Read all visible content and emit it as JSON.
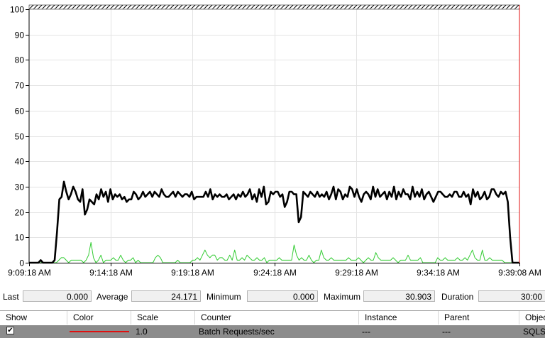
{
  "chart_data": {
    "type": "line",
    "ylim": [
      0,
      100
    ],
    "yticks": [
      "0",
      "10",
      "20",
      "30",
      "40",
      "50",
      "60",
      "70",
      "80",
      "90",
      "100"
    ],
    "xticks": [
      "9:09:18 AM",
      "9:14:18 AM",
      "9:19:18 AM",
      "9:24:18 AM",
      "9:29:18 AM",
      "9:34:18 AM",
      "9:39:08 AM"
    ],
    "grid": true,
    "series": [
      {
        "name": "Batch Requests/sec",
        "color": "#000000",
        "values": [
          0,
          0,
          0,
          0,
          0,
          1,
          0,
          0,
          0,
          0,
          0,
          1,
          12,
          25,
          26,
          32,
          28,
          25,
          27,
          30,
          28,
          25,
          24,
          29,
          19,
          21,
          25,
          24,
          23,
          27,
          25,
          29,
          26,
          28,
          24,
          29,
          25,
          27,
          26,
          27,
          25,
          26,
          24,
          25,
          25,
          28,
          27,
          25,
          26,
          28,
          26,
          27,
          28,
          26,
          28,
          27,
          26,
          29,
          27,
          26,
          26,
          27,
          28,
          26,
          28,
          27,
          26,
          27,
          27,
          26,
          28,
          25,
          26,
          26,
          26,
          26,
          28,
          26,
          29,
          25,
          27,
          26,
          27,
          26,
          26,
          27,
          25,
          26,
          27,
          25,
          27,
          26,
          28,
          26,
          27,
          29,
          25,
          27,
          24,
          29,
          26,
          30,
          23,
          24,
          28,
          27,
          28,
          28,
          26,
          27,
          22,
          24,
          28,
          28,
          27,
          27,
          16,
          18,
          28,
          27,
          26,
          28,
          27,
          26,
          28,
          26,
          27,
          26,
          28,
          25,
          27,
          30,
          25,
          29,
          28,
          25,
          27,
          26,
          30,
          29,
          26,
          29,
          26,
          24,
          27,
          28,
          27,
          25,
          30,
          26,
          29,
          26,
          27,
          28,
          25,
          28,
          26,
          30,
          25,
          28,
          26,
          29,
          27,
          27,
          25,
          30,
          26,
          28,
          26,
          29,
          25,
          27,
          28,
          26,
          24,
          26,
          28,
          28,
          27,
          26,
          26,
          27,
          26,
          28,
          28,
          26,
          26,
          28,
          26,
          27,
          23,
          29,
          26,
          28,
          25,
          26,
          28,
          25,
          26,
          29,
          29,
          27,
          26,
          28,
          27,
          28,
          24,
          10,
          0,
          0,
          0,
          0
        ]
      },
      {
        "name": "",
        "color": "#33cc33",
        "values": [
          0,
          0,
          0,
          0,
          0,
          0,
          0,
          0,
          0,
          0,
          0,
          0,
          1,
          2,
          2,
          1,
          0,
          1,
          1,
          1,
          1,
          1,
          0,
          1,
          3,
          8,
          2,
          0,
          1,
          3,
          0,
          1,
          1,
          1,
          2,
          1,
          1,
          3,
          1,
          0,
          1,
          1,
          2,
          0,
          1,
          0,
          0,
          0,
          0,
          0,
          0,
          2,
          3,
          2,
          0,
          0,
          0,
          0,
          0,
          0,
          1,
          0,
          0,
          0,
          0,
          0,
          1,
          1,
          2,
          1,
          3,
          5,
          3,
          2,
          3,
          3,
          1,
          2,
          2,
          1,
          1,
          3,
          1,
          5,
          1,
          1,
          2,
          1,
          3,
          2,
          1,
          1,
          2,
          1,
          1,
          2,
          0,
          1,
          1,
          1,
          1,
          2,
          1,
          1,
          1,
          1,
          1,
          7,
          3,
          1,
          2,
          1,
          1,
          3,
          1,
          0,
          1,
          1,
          5,
          2,
          1,
          1,
          2,
          1,
          1,
          1,
          1,
          1,
          1,
          2,
          1,
          1,
          1,
          2,
          1,
          0,
          1,
          2,
          1,
          1,
          4,
          2,
          1,
          1,
          1,
          1,
          1,
          2,
          1,
          0,
          1,
          1,
          1,
          3,
          1,
          1,
          1,
          1,
          2,
          0,
          0,
          0,
          0,
          0,
          0,
          2,
          1,
          1,
          2,
          1,
          1,
          1,
          1,
          2,
          1,
          1,
          2,
          1,
          3,
          5,
          2,
          1,
          1,
          5,
          1,
          1,
          2,
          1,
          1,
          1,
          1,
          1,
          0,
          0,
          0,
          0,
          0,
          0,
          0
        ]
      }
    ]
  },
  "stats": {
    "last_label": "Last",
    "last_value": "0.000",
    "average_label": "Average",
    "average_value": "24.171",
    "minimum_label": "Minimum",
    "minimum_value": "0.000",
    "maximum_label": "Maximum",
    "maximum_value": "30.903",
    "duration_label": "Duration",
    "duration_value": "30:00"
  },
  "table": {
    "headers": [
      "Show",
      "Color",
      "Scale",
      "Counter",
      "Instance",
      "Parent",
      "Object"
    ],
    "row": {
      "checked": "✔",
      "color": "#e01010",
      "scale": "1.0",
      "counter": "Batch Requests/sec",
      "instance": "---",
      "parent": "---",
      "object": "SQLServer:SQL Statistics"
    }
  }
}
